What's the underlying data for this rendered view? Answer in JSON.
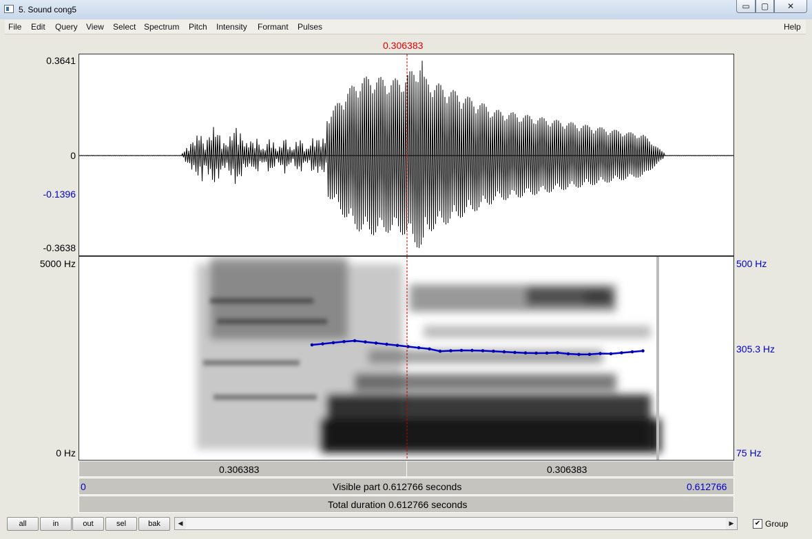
{
  "window": {
    "title": "5. Sound cong5",
    "min_glyph": "▭",
    "max_glyph": "▢",
    "close_glyph": "✕"
  },
  "menu": [
    "File",
    "Edit",
    "Query",
    "View",
    "Select",
    "Spectrum",
    "Pitch",
    "Intensity",
    "Formant",
    "Pulses"
  ],
  "menu_help": "Help",
  "cursor": {
    "time_label": "0.306383",
    "color": "#e00000"
  },
  "waveform": {
    "y_max": "0.3641",
    "y_zero": "0",
    "y_neg": "-0.1396",
    "y_min": "-0.3638"
  },
  "spectrogram": {
    "freq_top": "5000 Hz",
    "freq_bottom": "0 Hz"
  },
  "pitch": {
    "top": "500 Hz",
    "current": "305.3 Hz",
    "bottom": "75 Hz",
    "color": "#0000cc"
  },
  "time_bar": {
    "left_segment": "0.306383",
    "right_segment": "0.306383"
  },
  "visible_bar": {
    "start": "0",
    "label": "Visible part 0.612766 seconds",
    "end": "0.612766"
  },
  "total_bar": {
    "label": "Total duration 0.612766 seconds"
  },
  "buttons": {
    "all": "all",
    "in": "in",
    "out": "out",
    "sel": "sel",
    "bak": "bak"
  },
  "scrollbar": {
    "left_arrow": "◀",
    "right_arrow": "▶"
  },
  "group": {
    "label": "Group",
    "checked_glyph": "✔"
  }
}
